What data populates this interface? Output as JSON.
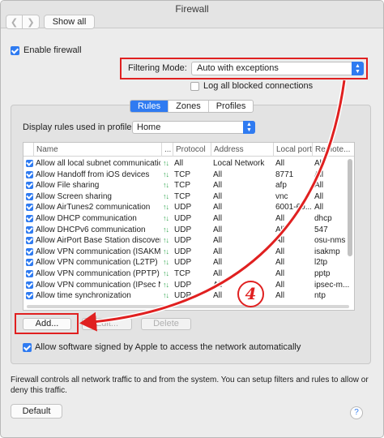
{
  "window": {
    "title": "Firewall"
  },
  "toolbar": {
    "show_all_label": "Show all",
    "back_icon": "chevron-left-icon",
    "forward_icon": "chevron-right-icon"
  },
  "enable_firewall": {
    "label": "Enable firewall",
    "checked": true
  },
  "filtering_mode": {
    "label": "Filtering Mode:",
    "value": "Auto with exceptions"
  },
  "log_blocked": {
    "label": "Log all blocked connections",
    "checked": false
  },
  "tabs": [
    {
      "label": "Rules",
      "active": true
    },
    {
      "label": "Zones",
      "active": false
    },
    {
      "label": "Profiles",
      "active": false
    }
  ],
  "profile": {
    "label": "Display rules used in profile:",
    "value": "Home"
  },
  "table": {
    "headers": [
      "Name",
      "...",
      "Protocol",
      "Address",
      "Local port",
      "Remote..."
    ],
    "rows": [
      {
        "name": "Allow all local subnet communication",
        "protocol": "All",
        "address": "Local Network",
        "local_port": "All",
        "remote": "All"
      },
      {
        "name": "Allow Handoff from iOS devices",
        "protocol": "TCP",
        "address": "All",
        "local_port": "8771",
        "remote": "All"
      },
      {
        "name": "Allow File sharing",
        "protocol": "TCP",
        "address": "All",
        "local_port": "afp",
        "remote": "All"
      },
      {
        "name": "Allow Screen sharing",
        "protocol": "TCP",
        "address": "All",
        "local_port": "vnc",
        "remote": "All"
      },
      {
        "name": "Allow AirTunes2 communication",
        "protocol": "UDP",
        "address": "All",
        "local_port": "6001-60...",
        "remote": "All"
      },
      {
        "name": "Allow DHCP communication",
        "protocol": "UDP",
        "address": "All",
        "local_port": "All",
        "remote": "dhcp"
      },
      {
        "name": "Allow DHCPv6 communication",
        "protocol": "UDP",
        "address": "All",
        "local_port": "All",
        "remote": "547"
      },
      {
        "name": "Allow AirPort Base Station discovery",
        "protocol": "UDP",
        "address": "All",
        "local_port": "All",
        "remote": "osu-nms"
      },
      {
        "name": "Allow VPN communication (ISAKMP...",
        "protocol": "UDP",
        "address": "All",
        "local_port": "All",
        "remote": "isakmp"
      },
      {
        "name": "Allow VPN communication (L2TP)",
        "protocol": "UDP",
        "address": "All",
        "local_port": "All",
        "remote": "l2tp"
      },
      {
        "name": "Allow VPN communication (PPTP)",
        "protocol": "TCP",
        "address": "All",
        "local_port": "All",
        "remote": "pptp"
      },
      {
        "name": "Allow VPN communication (IPsec N...",
        "protocol": "UDP",
        "address": "All",
        "local_port": "All",
        "remote": "ipsec-m..."
      },
      {
        "name": "Allow time synchronization",
        "protocol": "UDP",
        "address": "All",
        "local_port": "All",
        "remote": "ntp"
      }
    ]
  },
  "buttons": {
    "add": "Add...",
    "edit": "Edit...",
    "delete": "Delete"
  },
  "allow_signed": {
    "label": "Allow software signed by Apple to access the network automatically",
    "checked": true
  },
  "description": "Firewall controls all network traffic to and from the system. You can setup filters and rules to allow or deny this traffic.",
  "footer": {
    "default_label": "Default",
    "help_glyph": "?"
  },
  "annotation": {
    "step_number": "4",
    "color": "#e02020"
  },
  "colors": {
    "accent": "#2f7bf1",
    "highlight": "#e02020"
  }
}
